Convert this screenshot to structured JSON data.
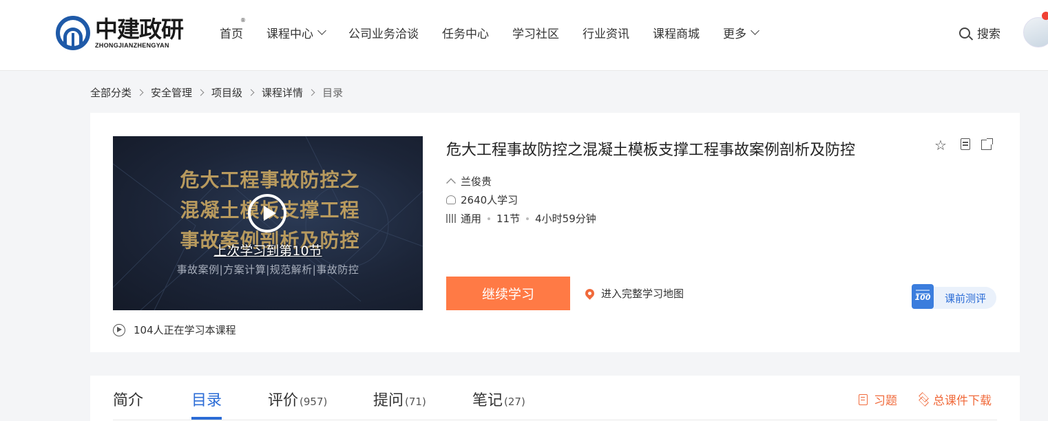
{
  "header": {
    "logo_cn": "中建政研",
    "logo_en": "ZHONGJIANZHENGYAN",
    "logo_reg": "®",
    "nav": [
      {
        "label": "首页",
        "has_dropdown": false
      },
      {
        "label": "课程中心",
        "has_dropdown": true
      },
      {
        "label": "公司业务洽谈",
        "has_dropdown": false
      },
      {
        "label": "任务中心",
        "has_dropdown": false
      },
      {
        "label": "学习社区",
        "has_dropdown": false
      },
      {
        "label": "行业资讯",
        "has_dropdown": false
      },
      {
        "label": "课程商城",
        "has_dropdown": false
      },
      {
        "label": "更多",
        "has_dropdown": true
      }
    ],
    "search_label": "搜索"
  },
  "breadcrumb": [
    "全部分类",
    "安全管理",
    "项目级",
    "课程详情",
    "目录"
  ],
  "course": {
    "cover": {
      "title_lines": [
        "危大工程事故防控之",
        "混凝土模板支撑工程",
        "事故案例剖析及防控"
      ],
      "subtitle": "事故案例|方案计算|规范解析|事故防控",
      "last_study": "上次学习到第10节"
    },
    "live_learners": "104人正在学习本课程",
    "title": "危大工程事故防控之混凝土模板支撑工程事故案例剖析及防控",
    "teacher": "兰俊贵",
    "learners": "2640人学习",
    "category": "通用",
    "sections": "11节",
    "duration": "4小时59分钟",
    "continue_label": "继续学习",
    "map_link": "进入完整学习地图",
    "pretest_icon_text": "100",
    "pretest_label": "课前测评",
    "accent_color": "#ff7a45",
    "link_color": "#2b6cd6"
  },
  "tabs": {
    "items": [
      {
        "label": "简介",
        "count": ""
      },
      {
        "label": "目录",
        "count": ""
      },
      {
        "label": "评价",
        "count": "(957)"
      },
      {
        "label": "提问",
        "count": "(71)"
      },
      {
        "label": "笔记",
        "count": "(27)"
      }
    ],
    "active": "目录",
    "actions": {
      "exercises": "习题",
      "download": "总课件下载"
    }
  }
}
